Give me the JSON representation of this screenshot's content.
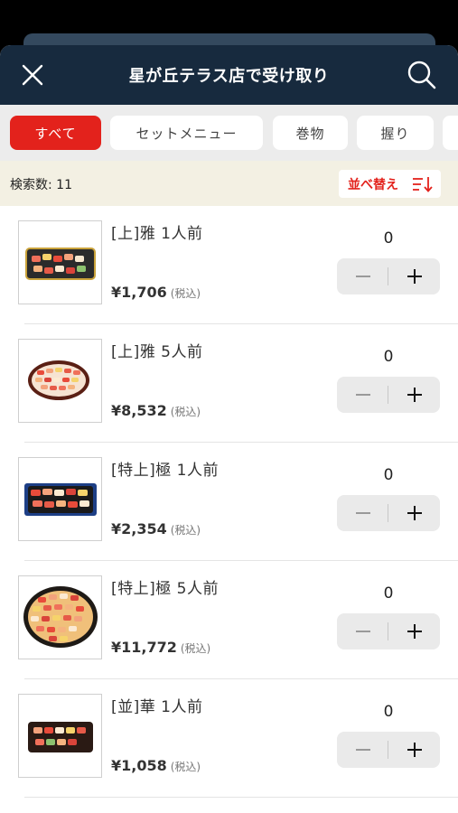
{
  "header": {
    "title": "星が丘テラス店で受け取り",
    "close_icon": "close-icon",
    "search_icon": "search-icon"
  },
  "tabs": [
    {
      "label": "すべて",
      "active": true
    },
    {
      "label": "セットメニュー",
      "active": false
    },
    {
      "label": "巻物",
      "active": false
    },
    {
      "label": "握り",
      "active": false
    },
    {
      "label": "",
      "active": false
    }
  ],
  "results": {
    "count_label": "検索数: 11",
    "sort_label": "並べ替え",
    "sort_icon": "sort-descending-icon"
  },
  "items": [
    {
      "name": "[上]雅 1人前",
      "price": "¥1,706",
      "tax": "(税込)",
      "qty": "0"
    },
    {
      "name": "[上]雅 5人前",
      "price": "¥8,532",
      "tax": "(税込)",
      "qty": "0"
    },
    {
      "name": "[特上]極 1人前",
      "price": "¥2,354",
      "tax": "(税込)",
      "qty": "0"
    },
    {
      "name": "[特上]極 5人前",
      "price": "¥11,772",
      "tax": "(税込)",
      "qty": "0"
    },
    {
      "name": "[並]華 1人前",
      "price": "¥1,058",
      "tax": "(税込)",
      "qty": "0"
    }
  ],
  "colors": {
    "header_bg": "#172a3e",
    "accent_red": "#e3221c",
    "tab_bar_bg": "#ececec",
    "count_bar_bg": "#f3f0e3"
  }
}
